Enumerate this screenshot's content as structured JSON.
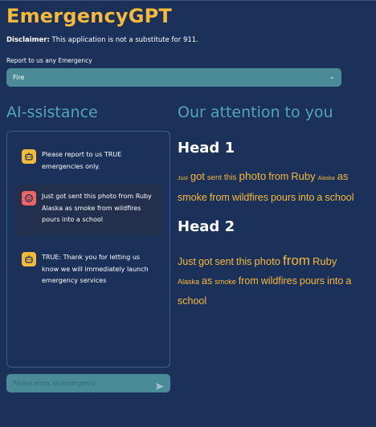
{
  "app": {
    "title": "EmergencyGPT",
    "disclaimer_label": "Disclaimer:",
    "disclaimer_text": " This application is not a substitute for 911."
  },
  "emergency_select": {
    "label": "Report to us any Emergency",
    "value": "Fire"
  },
  "left_panel": {
    "title": "AI-ssistance",
    "messages": [
      {
        "role": "assistant",
        "text": "Please report to us TRUE emergencies only."
      },
      {
        "role": "user",
        "text": "Just got sent this photo from Ruby Alaska as smoke from wildfires pours into a school"
      },
      {
        "role": "assistant",
        "text": "TRUE: Thank you for letting us know we will immediately launch emergency services"
      }
    ],
    "input_placeholder": "Please enter an emergency"
  },
  "right_panel": {
    "title": "Our attention to you",
    "head1": "Head 1",
    "cloud1": [
      "Just",
      "got",
      "sent",
      "this",
      "photo",
      "from",
      "Ruby",
      "Alaska",
      "as",
      "smoke",
      "from",
      "wildfires",
      "pours",
      "into",
      "a",
      "school"
    ],
    "head2": "Head 2",
    "cloud2": [
      "Just",
      "got",
      "sent",
      "this",
      "photo",
      "from",
      "Ruby",
      "Alaska",
      "as",
      "smoke",
      "from",
      "wildfires",
      "pours",
      "into",
      "a",
      "school"
    ]
  },
  "colors": {
    "background": "#1b3159",
    "accent_gold": "#f5b93b",
    "accent_teal": "#53a6b6",
    "input_fill": "#4b8a97",
    "user_avatar": "#f06464"
  },
  "icons": {
    "assistant_avatar": "robot-icon",
    "user_avatar": "face-icon",
    "select_chevron": "chevron-down-icon",
    "send": "send-icon"
  }
}
